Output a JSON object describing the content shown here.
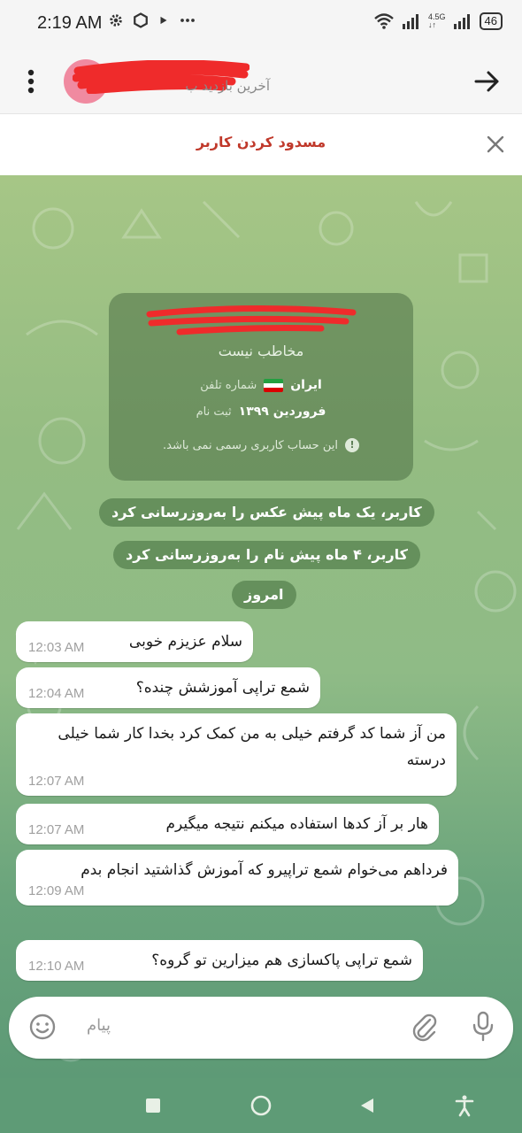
{
  "status_bar": {
    "time": "2:19 AM",
    "network_label": "4.5G",
    "battery": "46",
    "left_icons": [
      "gear-icon",
      "hexagon-icon",
      "play-icon",
      "more-dots-icon"
    ],
    "right_icons": [
      "wifi-icon",
      "signal-icon",
      "signal-icon",
      "battery-icon"
    ]
  },
  "header": {
    "subtitle": "آخرین بازدید ب",
    "menu_icon": "kebab-menu-icon",
    "back_icon": "arrow-right-icon"
  },
  "block_bar": {
    "label": "مسدود کردن کاربر",
    "close_icon": "close-icon"
  },
  "info_card": {
    "subtitle": "مخاطب نیست",
    "phone_value": "ایران",
    "phone_label": "شماره تلفن",
    "registered_value": "فروردین ۱۳۹۹",
    "registered_label": "ثبت نام",
    "note": "این حساب کاربری رسمی نمی باشد."
  },
  "service_messages": [
    "کاربر، یک ماه پیش عکس را به‌روزرسانی کرد",
    "کاربر، ۴ ماه پیش نام را به‌روزرسانی کرد",
    "امروز"
  ],
  "messages": [
    {
      "text": "سلام عزیزم خوبی",
      "time": "12:03 AM"
    },
    {
      "text": "شمع تراپی آموزشش چنده؟",
      "time": "12:04 AM"
    },
    {
      "text": "من آز شما کد گرفتم خیلی به من کمک کرد بخدا کار شما خیلی درسته",
      "time": "12:07 AM"
    },
    {
      "text": "هار بر آز کدها استفاده میکنم نتیجه میگیرم",
      "time": "12:07 AM"
    },
    {
      "text": "فرداهم می‌خوام شمع تراپیرو که آموزش گذاشتید انجام بدم",
      "time": "12:09 AM"
    },
    {
      "text": "شمع تراپی پاکسازی هم میزارین تو گروه؟",
      "time": "12:10 AM"
    }
  ],
  "composer": {
    "placeholder": "پیام",
    "emoji_icon": "emoji-icon",
    "attach_icon": "paperclip-icon",
    "mic_icon": "microphone-icon"
  },
  "nav_bar": {
    "icons": [
      "recent-apps-icon",
      "home-icon",
      "back-icon",
      "accessibility-icon"
    ]
  },
  "colors": {
    "block_text": "#c0392b",
    "chat_bg": "#8fbb86",
    "pill_bg": "#4a7644"
  }
}
